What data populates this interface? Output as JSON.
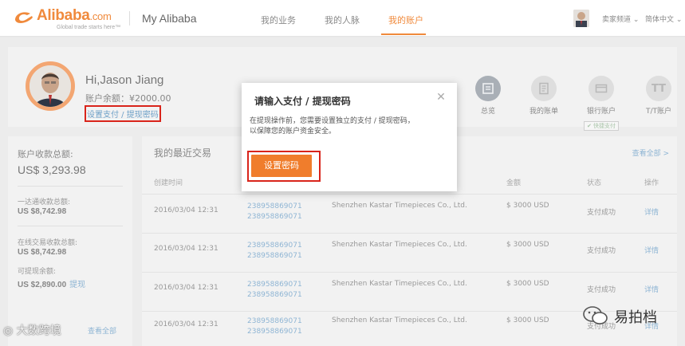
{
  "header": {
    "logo_text": "Alibaba",
    "logo_suffix": ".com",
    "logo_tagline": "Global trade starts here™",
    "myalibaba": "My Alibaba",
    "tabs": [
      {
        "label": "我的业务",
        "active": false
      },
      {
        "label": "我的人脉",
        "active": false
      },
      {
        "label": "我的账户",
        "active": true
      }
    ],
    "seller_channel": "卖家频道",
    "language": "简体中文"
  },
  "profile": {
    "greeting": "Hi,Jason Jiang",
    "balance": "账户余额：¥2000.00",
    "set_password_link": "设置支付 / 提现密码"
  },
  "quick_actions": [
    {
      "label": "总览",
      "icon": "overview-icon",
      "active": true
    },
    {
      "label": "我的账单",
      "icon": "bill-icon",
      "active": false
    },
    {
      "label": "银行账户",
      "icon": "bank-card-icon",
      "active": false,
      "badge": "✔ 快捷支付"
    },
    {
      "label": "T/T账户",
      "icon": "tt-icon",
      "glyph": "TT",
      "active": false
    }
  ],
  "summary": {
    "total_label": "账户收款总额:",
    "total_value": "US$ 3,293.98",
    "yidatong_label": "一达通收款总额:",
    "yidatong_value": "US $8,742.98",
    "online_label": "在线交易收款总额:",
    "online_value": "US $8,742.98",
    "withdrawable_label": "可提现余额:",
    "withdrawable_value": "US $2,890.00",
    "withdraw_link": "提现",
    "view_all": "查看全部"
  },
  "transactions": {
    "title": "我的最近交易",
    "view_all": "查看全部 >",
    "columns": [
      "创建时间",
      "金额",
      "状态",
      "操作"
    ],
    "rows": [
      {
        "time": "2016/03/04  12:31",
        "order1": "238958869071",
        "order2": "238958869071",
        "company": "Shenzhen Kastar Timepieces Co., Ltd.",
        "amount": "$ 3000 USD",
        "status": "支付成功",
        "action": "详情"
      },
      {
        "time": "2016/03/04  12:31",
        "order1": "238958869071",
        "order2": "238958869071",
        "company": "Shenzhen Kastar Timepieces Co., Ltd.",
        "amount": "$ 3000 USD",
        "status": "支付成功",
        "action": "详情"
      },
      {
        "time": "2016/03/04  12:31",
        "order1": "238958869071",
        "order2": "238958869071",
        "company": "Shenzhen Kastar Timepieces Co., Ltd.",
        "amount": "$ 3000 USD",
        "status": "支付成功",
        "action": "详情"
      },
      {
        "time": "2016/03/04  12:31",
        "order1": "238958869071",
        "order2": "238958869071",
        "company": "Shenzhen Kastar Timepieces Co., Ltd.",
        "amount": "$ 3000 USD",
        "status": "支付成功",
        "action": "详情"
      }
    ]
  },
  "modal": {
    "title": "请输入支付 / 提现密码",
    "desc_line1": "在提现操作前，您需要设置独立的支付 / 提现密码，",
    "desc_line2": "以保障您的账户资金安全。",
    "button": "设置密码"
  },
  "watermarks": {
    "left": "大数跨境",
    "right": "易拍档"
  },
  "colors": {
    "brand": "#f08a3c",
    "button": "#f07d2c",
    "highlight_border": "#d9241b",
    "link": "#8fb5d4"
  }
}
